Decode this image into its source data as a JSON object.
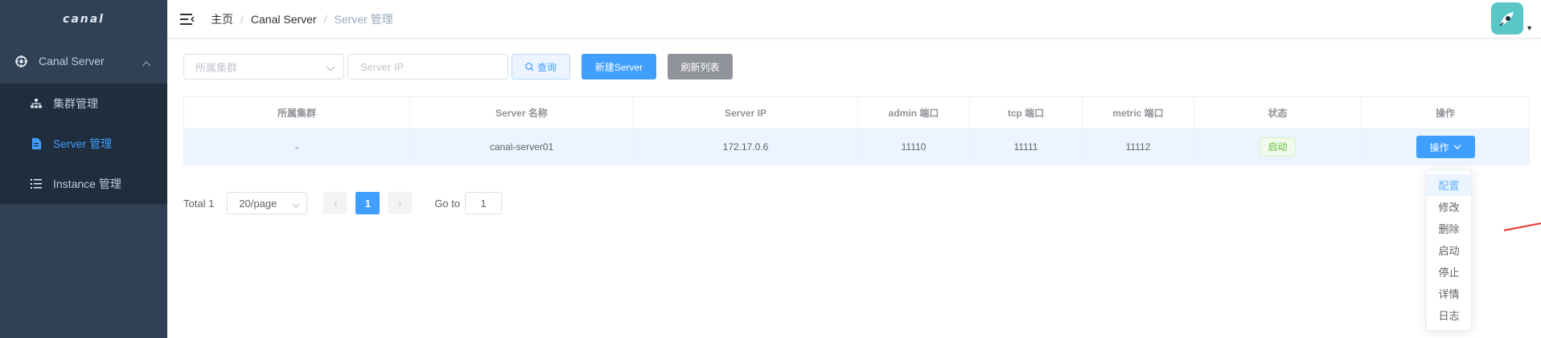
{
  "app": {
    "logo_text": "canal"
  },
  "sidebar": {
    "group": {
      "label": "Canal Server",
      "icon": "settings-icon"
    },
    "items": [
      {
        "label": "集群管理",
        "icon": "cluster-icon",
        "active": false
      },
      {
        "label": "Server 管理",
        "icon": "document-icon",
        "active": true
      },
      {
        "label": "Instance 管理",
        "icon": "list-icon",
        "active": false
      }
    ]
  },
  "header": {
    "breadcrumb": [
      "主页",
      "Canal Server",
      "Server 管理"
    ],
    "separator": "/"
  },
  "filters": {
    "cluster_placeholder": "所属集群",
    "ip_placeholder": "Server IP",
    "query_label": "查询",
    "new_label": "新建Server",
    "refresh_label": "刷新列表"
  },
  "table": {
    "columns": [
      "所属集群",
      "Server 名称",
      "Server IP",
      "admin 端口",
      "tcp 端口",
      "metric 端口",
      "状态",
      "操作"
    ],
    "rows": [
      {
        "cluster": "-",
        "name": "canal-server01",
        "ip": "172.17.0.6",
        "admin_port": "11110",
        "tcp_port": "11111",
        "metric_port": "11112",
        "status": "启动",
        "action": "操作"
      }
    ]
  },
  "pagination": {
    "total_text": "Total 1",
    "page_size": "20/page",
    "prev": "‹",
    "current_page": "1",
    "next": "›",
    "goto_label": "Go to",
    "goto_value": "1"
  },
  "dropdown": {
    "items": [
      "配置",
      "修改",
      "删除",
      "启动",
      "停止",
      "详情",
      "日志"
    ],
    "highlighted": "配置"
  },
  "colors": {
    "sidebar_bg": "#304156",
    "submenu_bg": "#1f2d3d",
    "primary": "#409eff",
    "success": "#67c23a",
    "annotation_arrow": "#e8322b"
  }
}
